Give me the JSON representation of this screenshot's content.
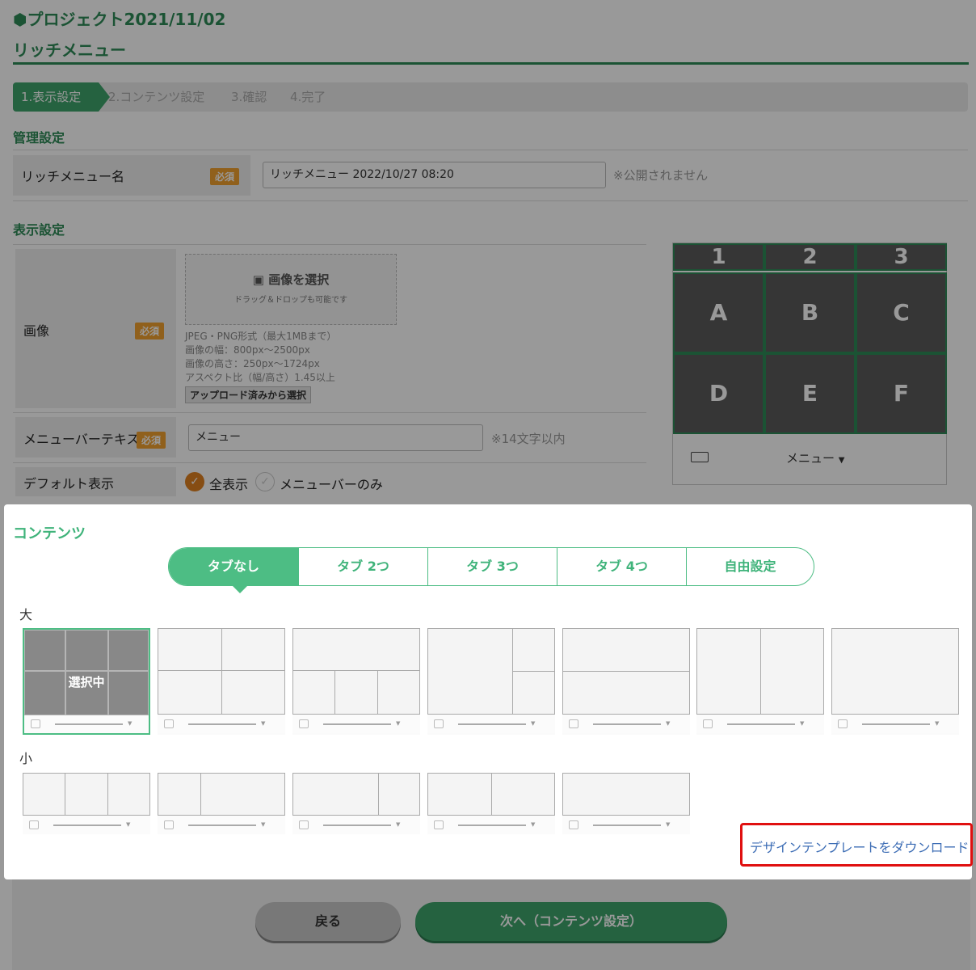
{
  "header": {
    "project_title": "プロジェクト2021/11/02",
    "page_title": "リッチメニュー"
  },
  "steps": [
    "1.表示設定",
    "2.コンテンツ設定",
    "3.確認",
    "4.完了"
  ],
  "management": {
    "heading": "管理設定",
    "name_label": "リッチメニュー名",
    "required": "必須",
    "name_value": "リッチメニュー 2022/10/27 08:20",
    "name_note": "※公開されません"
  },
  "display": {
    "heading": "表示設定",
    "image_label": "画像",
    "image_select": "画像を選択",
    "image_drag": "ドラッグ＆ドロップも可能です",
    "image_notes": [
      "JPEG・PNG形式（最大1MBまで）",
      "画像の幅：800px～2500px",
      "画像の高さ：250px～1724px",
      "アスペクト比（幅/高さ）1.45以上"
    ],
    "upload_button": "アップロード済みから選択",
    "menubar_label": "メニューバーテキスト",
    "menubar_value": "メニュー",
    "menubar_note": "※14文字以内",
    "default_label": "デフォルト表示",
    "option_all": "全表示",
    "option_bar": "メニューバーのみ"
  },
  "preview": {
    "tabs": [
      "1",
      "2",
      "3"
    ],
    "cells": [
      "A",
      "B",
      "C",
      "D",
      "E",
      "F"
    ],
    "menu_text": "メニュー"
  },
  "modal": {
    "heading": "コンテンツ",
    "tabs": [
      "タブなし",
      "タブ 2つ",
      "タブ 3つ",
      "タブ 4つ",
      "自由設定"
    ],
    "large_label": "大",
    "small_label": "小",
    "selected_text": "選択中",
    "download_link": "デザインテンプレートをダウンロード"
  },
  "footer": {
    "back": "戻る",
    "next": "次へ（コンテンツ設定）"
  },
  "colors": {
    "brand_green": "#2e8a57",
    "tab_green": "#4dbd84",
    "required_orange": "#f0a030",
    "highlight_red": "#e01010",
    "link_blue": "#3d6db5"
  }
}
